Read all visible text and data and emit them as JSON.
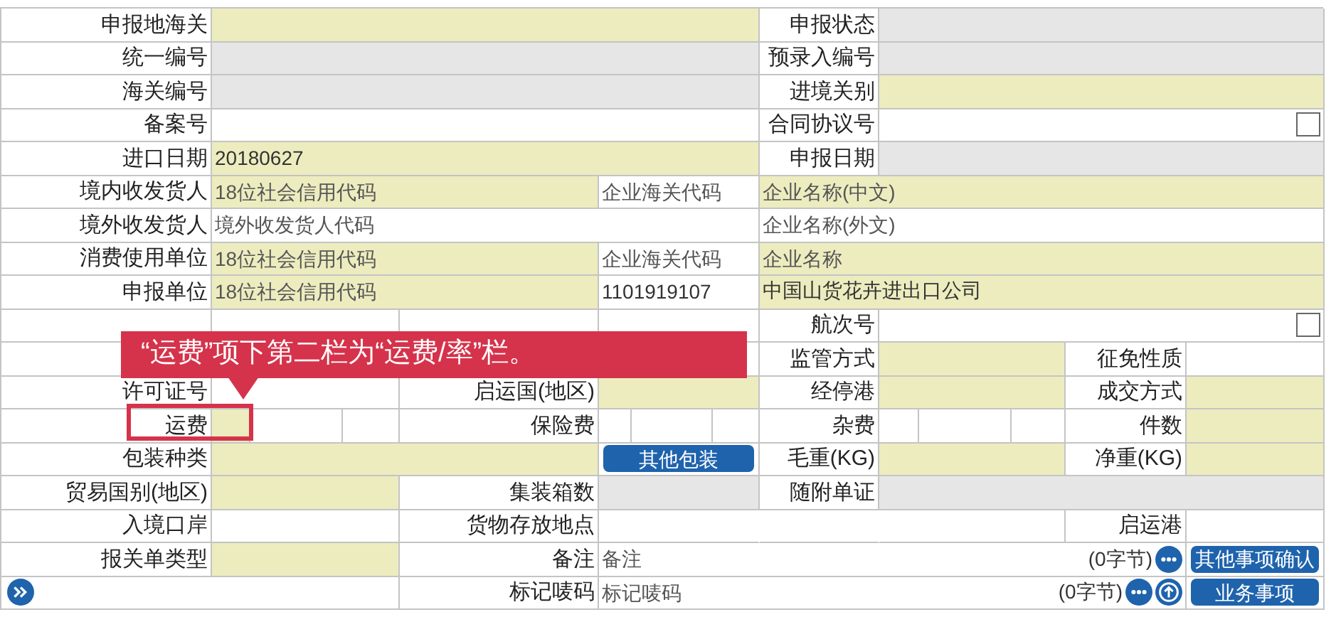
{
  "form": {
    "rows": [
      {
        "cells": [
          {
            "kind": "label",
            "text": "申报地海关"
          },
          {
            "kind": "field",
            "required": true,
            "readonly": false
          },
          {
            "kind": "label",
            "text": "申报状态"
          },
          {
            "kind": "field",
            "required": false,
            "readonly": true
          }
        ]
      },
      {
        "cells": [
          {
            "kind": "label",
            "text": "统一编号"
          },
          {
            "kind": "field",
            "required": false,
            "readonly": true
          },
          {
            "kind": "label",
            "text": "预录入编号"
          },
          {
            "kind": "field",
            "required": false,
            "readonly": true
          }
        ]
      },
      {
        "cells": [
          {
            "kind": "label",
            "text": "海关编号"
          },
          {
            "kind": "field",
            "required": false,
            "readonly": true
          },
          {
            "kind": "label",
            "text": "进境关别"
          },
          {
            "kind": "field",
            "required": true,
            "readonly": false
          }
        ]
      },
      {
        "cells": [
          {
            "kind": "label",
            "text": "备案号"
          },
          {
            "kind": "field",
            "required": false,
            "readonly": false
          },
          {
            "kind": "label",
            "text": "合同协议号"
          },
          {
            "kind": "field",
            "required": false,
            "readonly": false,
            "checkbox": {
              "checked": false
            }
          }
        ]
      },
      {
        "cells": [
          {
            "kind": "label",
            "text": "进口日期"
          },
          {
            "kind": "field",
            "required": true,
            "readonly": false,
            "value": "20180627"
          },
          {
            "kind": "label",
            "text": "申报日期"
          },
          {
            "kind": "field",
            "required": false,
            "readonly": true
          }
        ]
      },
      {
        "cells": [
          {
            "kind": "label",
            "text": "境内收发货人"
          },
          {
            "kind": "field",
            "required": true,
            "readonly": false,
            "placeholder": "18位社会信用代码"
          },
          {
            "kind": "field",
            "required": false,
            "readonly": false,
            "placeholder": "企业海关代码"
          },
          {
            "kind": "field",
            "required": true,
            "readonly": false,
            "placeholder": "企业名称(中文)"
          }
        ]
      },
      {
        "cells": [
          {
            "kind": "label",
            "text": "境外收发货人"
          },
          {
            "kind": "field",
            "required": false,
            "readonly": false,
            "placeholder": "境外收发货人代码"
          },
          {
            "kind": "field",
            "required": false,
            "readonly": false,
            "placeholder": "企业名称(外文)"
          }
        ]
      },
      {
        "cells": [
          {
            "kind": "label",
            "text": "消费使用单位"
          },
          {
            "kind": "field",
            "required": true,
            "readonly": false,
            "placeholder": "18位社会信用代码"
          },
          {
            "kind": "field",
            "required": false,
            "readonly": false,
            "placeholder": "企业海关代码"
          },
          {
            "kind": "field",
            "required": true,
            "readonly": false,
            "placeholder": "企业名称"
          }
        ]
      },
      {
        "cells": [
          {
            "kind": "label",
            "text": "申报单位"
          },
          {
            "kind": "field",
            "required": true,
            "readonly": false,
            "placeholder": "18位社会信用代码"
          },
          {
            "kind": "field",
            "required": false,
            "readonly": false,
            "value": "1101919107"
          },
          {
            "kind": "field",
            "required": true,
            "readonly": false,
            "value": "中国山货花卉进出口公司"
          }
        ]
      },
      {
        "cells": [
          {
            "kind": "label"
          },
          {
            "kind": "field",
            "required": false,
            "readonly": false
          },
          {
            "kind": "label"
          },
          {
            "kind": "field",
            "required": false,
            "readonly": false
          },
          {
            "kind": "label",
            "text": "航次号"
          },
          {
            "kind": "field",
            "required": false,
            "readonly": false,
            "checkbox": {
              "checked": false
            }
          }
        ]
      },
      {
        "cells": [
          {
            "kind": "label"
          },
          {
            "kind": "field"
          },
          {
            "kind": "label"
          },
          {
            "kind": "field"
          },
          {
            "kind": "label",
            "text": "监管方式"
          },
          {
            "kind": "field",
            "required": true,
            "readonly": false
          },
          {
            "kind": "label",
            "text": "征免性质"
          },
          {
            "kind": "field",
            "required": false,
            "readonly": false
          }
        ]
      },
      {
        "cells": [
          {
            "kind": "label",
            "text": "许可证号"
          },
          {
            "kind": "field",
            "required": false,
            "readonly": false
          },
          {
            "kind": "label",
            "text": "启运国(地区)"
          },
          {
            "kind": "field",
            "required": true,
            "readonly": false
          },
          {
            "kind": "label",
            "text": "经停港"
          },
          {
            "kind": "field",
            "required": true,
            "readonly": false
          },
          {
            "kind": "label",
            "text": "成交方式"
          },
          {
            "kind": "field",
            "required": true,
            "readonly": false
          }
        ]
      },
      {
        "cells": [
          {
            "kind": "label",
            "text": "运费"
          },
          {
            "kind": "field",
            "required": true,
            "readonly": false
          },
          {
            "kind": "field",
            "required": false,
            "readonly": false
          },
          {
            "kind": "field",
            "required": false,
            "readonly": false
          },
          {
            "kind": "label",
            "text": "保险费"
          },
          {
            "kind": "field",
            "required": false,
            "readonly": false
          },
          {
            "kind": "field",
            "required": false,
            "readonly": false
          },
          {
            "kind": "field",
            "required": false,
            "readonly": false
          },
          {
            "kind": "label",
            "text": "杂费"
          },
          {
            "kind": "field",
            "required": false,
            "readonly": false
          },
          {
            "kind": "field",
            "required": false,
            "readonly": false
          },
          {
            "kind": "field",
            "required": false,
            "readonly": false
          },
          {
            "kind": "label",
            "text": "件数"
          },
          {
            "kind": "field",
            "required": true,
            "readonly": false
          }
        ]
      },
      {
        "cells": [
          {
            "kind": "label",
            "text": "包装种类"
          },
          {
            "kind": "field",
            "required": true,
            "readonly": false
          },
          {
            "kind": "button",
            "text": "其他包装"
          },
          {
            "kind": "label",
            "text": "毛重(KG)"
          },
          {
            "kind": "field",
            "required": true,
            "readonly": false
          },
          {
            "kind": "label",
            "text": "净重(KG)"
          },
          {
            "kind": "field",
            "required": true,
            "readonly": false
          }
        ]
      },
      {
        "cells": [
          {
            "kind": "label",
            "text": "贸易国别(地区)"
          },
          {
            "kind": "field",
            "required": true,
            "readonly": false
          },
          {
            "kind": "label",
            "text": "集装箱数"
          },
          {
            "kind": "field",
            "required": false,
            "readonly": true
          },
          {
            "kind": "label",
            "text": "随附单证"
          },
          {
            "kind": "field",
            "required": false,
            "readonly": true
          }
        ]
      },
      {
        "cells": [
          {
            "kind": "label",
            "text": "入境口岸"
          },
          {
            "kind": "field",
            "required": false,
            "readonly": false
          },
          {
            "kind": "label",
            "text": "货物存放地点"
          },
          {
            "kind": "field",
            "required": false,
            "readonly": false
          },
          {
            "kind": "label"
          },
          {
            "kind": "field",
            "required": false,
            "readonly": false
          },
          {
            "kind": "label",
            "text": "启运港"
          },
          {
            "kind": "field",
            "required": false,
            "readonly": false
          }
        ]
      },
      {
        "cells": [
          {
            "kind": "label",
            "text": "报关单类型"
          },
          {
            "kind": "field",
            "required": true,
            "readonly": false
          },
          {
            "kind": "label",
            "text": "备注"
          },
          {
            "kind": "field",
            "required": false,
            "readonly": false,
            "placeholder": "备注",
            "byte_count": "(0字节)",
            "icons": [
              {
                "kind": "more"
              }
            ]
          },
          {
            "kind": "button",
            "text": "其他事项确认"
          }
        ]
      },
      {
        "cells": [
          {
            "kind": "expand"
          },
          {
            "kind": "label",
            "text": "标记唛码"
          },
          {
            "kind": "field",
            "required": false,
            "readonly": false,
            "placeholder": "标记唛码",
            "byte_count": "(0字节)",
            "icons": [
              {
                "kind": "more"
              },
              {
                "kind": "upload"
              }
            ]
          },
          {
            "kind": "button",
            "text": "业务事项"
          }
        ]
      }
    ]
  },
  "callout": {
    "text": "“运费”项下第二栏为“运费/率”栏。"
  }
}
